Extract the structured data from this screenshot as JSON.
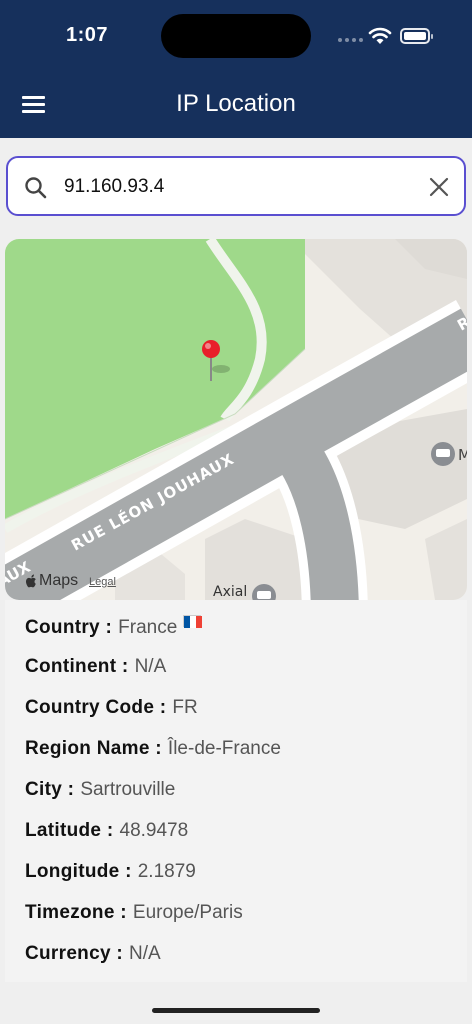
{
  "status_bar": {
    "time": "1:07"
  },
  "header": {
    "title": "IP Location"
  },
  "search": {
    "value": "91.160.93.4"
  },
  "map": {
    "street_name": "RUE LÉON JOUHAUX",
    "edge_letter_right": "R",
    "edge_letter_left": "AUX",
    "poi_label": "Axial",
    "poi_edge_label": "M",
    "attribution": "Maps",
    "legal": "Legal"
  },
  "details": {
    "rows": [
      {
        "label": "Country :",
        "value": "France"
      },
      {
        "label": "Continent :",
        "value": "N/A"
      },
      {
        "label": "Country Code :",
        "value": "FR"
      },
      {
        "label": "Region Name :",
        "value": "Île-de-France"
      },
      {
        "label": "City :",
        "value": "Sartrouville"
      },
      {
        "label": "Latitude :",
        "value": "48.9478"
      },
      {
        "label": "Longitude :",
        "value": "2.1879"
      },
      {
        "label": "Timezone :",
        "value": "Europe/Paris"
      },
      {
        "label": "Currency :",
        "value": "N/A"
      }
    ],
    "flag_colors": [
      "#0055a4",
      "#ffffff",
      "#ef4135"
    ]
  },
  "colors": {
    "header_bg": "#16305c",
    "search_border": "#5a4fd0",
    "park": "#9fd98a",
    "road": "#a7aaab",
    "pin": "#e8202a"
  }
}
